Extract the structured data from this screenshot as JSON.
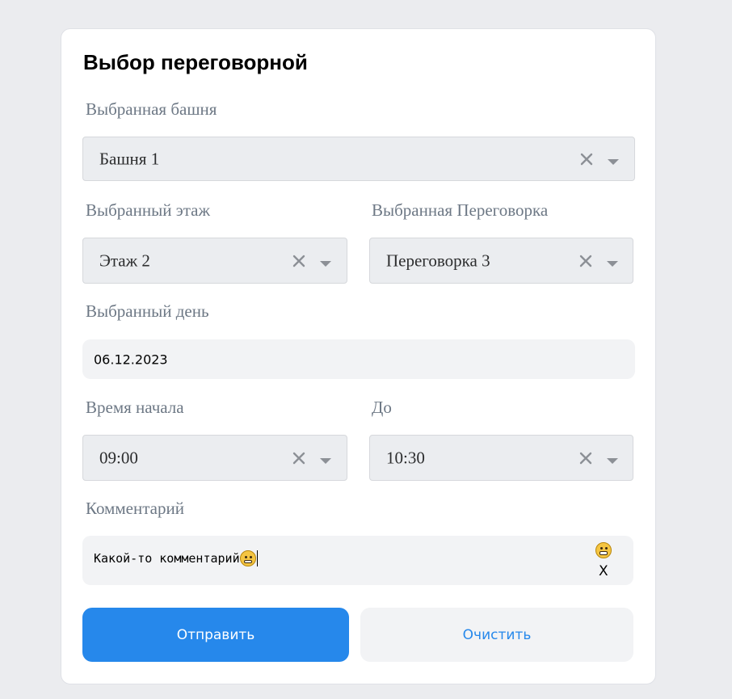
{
  "form": {
    "title": "Выбор переговорной",
    "tower": {
      "label": "Выбранная башня",
      "value": "Башня 1"
    },
    "floor": {
      "label": "Выбранный этаж",
      "value": "Этаж 2"
    },
    "room": {
      "label": "Выбранная Переговорка",
      "value": "Переговорка 3"
    },
    "day": {
      "label": "Выбранный день",
      "value": "06.12.2023"
    },
    "start": {
      "label": "Время начала",
      "value": "09:00"
    },
    "end": {
      "label": "До",
      "value": "10:30"
    },
    "comment": {
      "label": "Комментарий",
      "value": "Какой-то комментарий",
      "clear_label": "X"
    },
    "submit_label": "Отправить",
    "reset_label": "Очистить"
  },
  "icons": {
    "clear": "close-icon",
    "dropdown": "chevron-down-icon",
    "emoji_inline": "grimacing-face-emoji",
    "emoji_picker": "grinning-face-emoji"
  },
  "colors": {
    "accent": "#2688eb",
    "page_background": "#ebecef",
    "field_background": "#ebedf0",
    "label_text": "#6d7885"
  }
}
